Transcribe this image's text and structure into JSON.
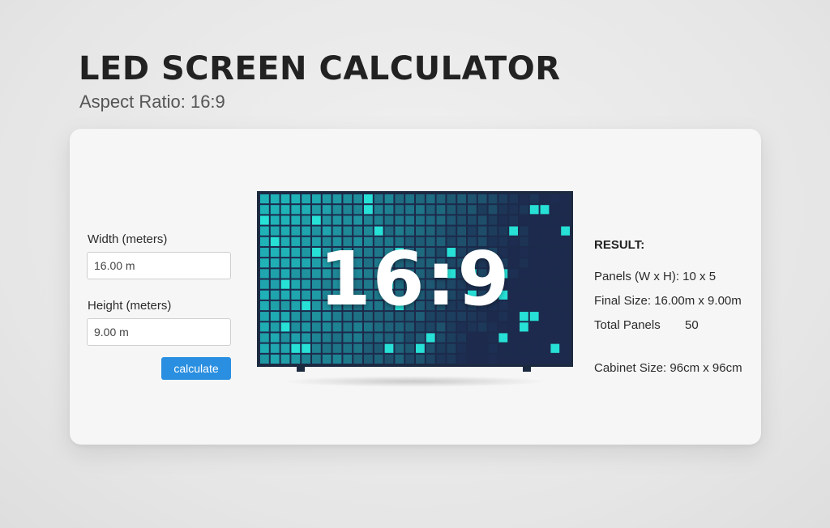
{
  "header": {
    "title": "LED SCREEN CALCULATOR",
    "subtitle": "Aspect Ratio: 16:9"
  },
  "form": {
    "width_label": "Width (meters)",
    "width_value": "16.00 m",
    "height_label": "Height (meters)",
    "height_value": "9.00 m",
    "calculate_label": "calculate"
  },
  "preview": {
    "ratio_text": "16:9",
    "grid_cols": 30,
    "grid_rows": 16,
    "colors": {
      "bright": "#27e0d6",
      "teal": "#1fb3b8",
      "dark": "#1d2a4e"
    }
  },
  "result": {
    "title": "RESULT:",
    "panels": "Panels (W x H): 10 x 5",
    "final_size": "Final Size: 16.00m x 9.00m",
    "total_label": "Total Panels",
    "total_value": "50",
    "cabinet": "Cabinet Size: 96cm x 96cm"
  }
}
